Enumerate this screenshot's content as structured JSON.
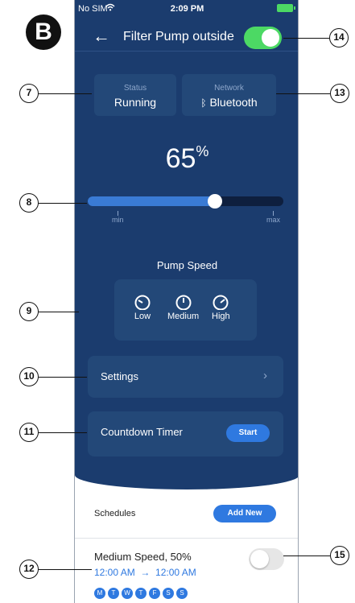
{
  "figure_badge": "B",
  "status_bar": {
    "carrier": "No SIM",
    "time": "2:09 PM"
  },
  "header": {
    "back_icon": "arrow-left-icon",
    "title": "Filter Pump outside",
    "power_on": true
  },
  "info": {
    "status": {
      "label": "Status",
      "value": "Running"
    },
    "network": {
      "label": "Network",
      "value": "Bluetooth",
      "icon": "bluetooth-icon"
    }
  },
  "speed_display": {
    "value": "65",
    "unit": "%"
  },
  "slider": {
    "value_percent": 65,
    "min_label": "min",
    "max_label": "max"
  },
  "pump_speed": {
    "label": "Pump Speed",
    "options": [
      {
        "label": "Low",
        "icon": "gauge-low-icon"
      },
      {
        "label": "Medium",
        "icon": "gauge-medium-icon"
      },
      {
        "label": "High",
        "icon": "gauge-high-icon"
      }
    ]
  },
  "settings": {
    "label": "Settings",
    "icon": "chevron-right-icon"
  },
  "countdown": {
    "label": "Countdown Timer",
    "button": "Start"
  },
  "schedules": {
    "title": "Schedules",
    "add_button": "Add New",
    "item": {
      "title": "Medium Speed, 50%",
      "start": "12:00 AM",
      "arrow": "→",
      "end": "12:00 AM",
      "enabled": false,
      "days": [
        "M",
        "T",
        "W",
        "T",
        "F",
        "S",
        "S"
      ]
    }
  },
  "callouts": [
    "7",
    "8",
    "9",
    "10",
    "11",
    "12",
    "13",
    "14",
    "15"
  ],
  "colors": {
    "panel": "#1b3c6e",
    "card": "#234878",
    "accent": "#2f79e0",
    "toggle_on": "#4cd964"
  }
}
